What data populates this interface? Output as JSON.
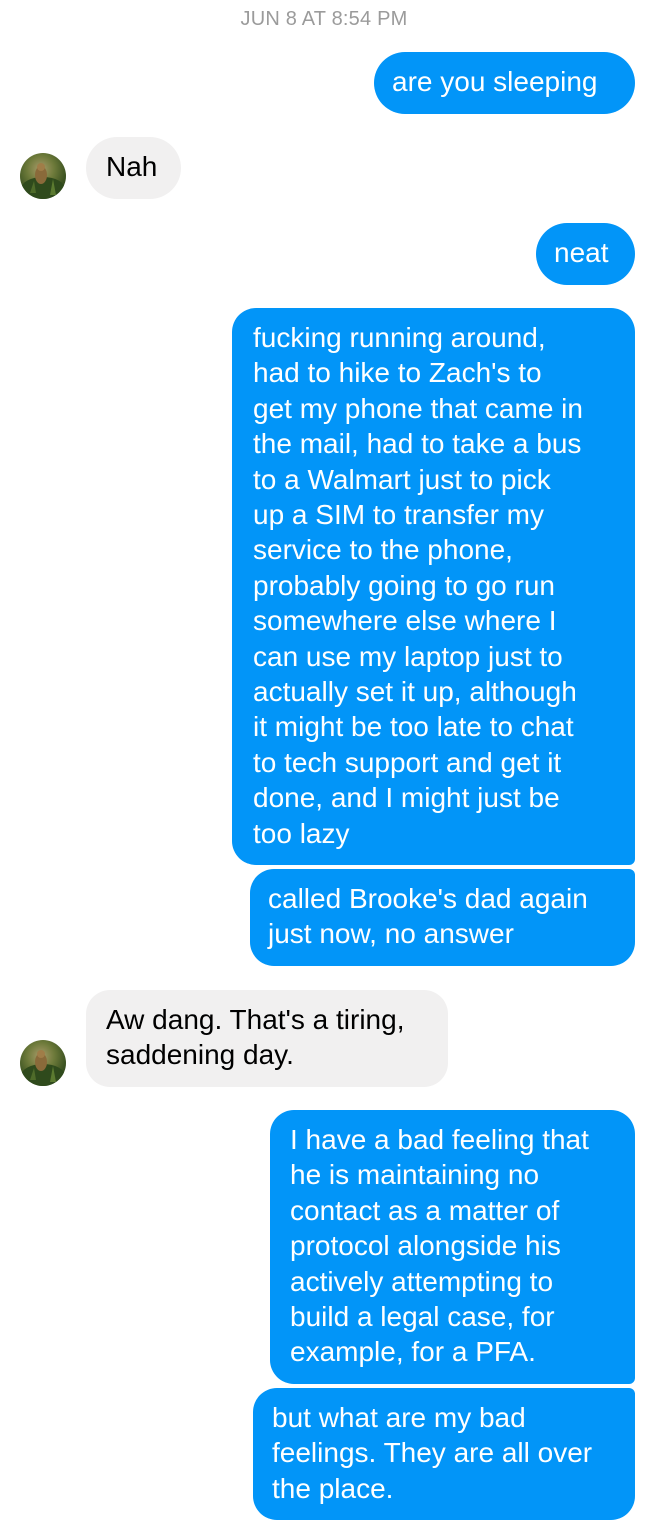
{
  "conversation": {
    "timestamp": "JUN 8 AT 8:54 PM",
    "messages": [
      {
        "sender": "me",
        "text": "are you sleeping"
      },
      {
        "sender": "contact",
        "text": "Nah"
      },
      {
        "sender": "me",
        "text": "neat"
      },
      {
        "sender": "me",
        "text": "fucking running around,\nhad to hike to Zach's to\nget my phone that came in\nthe mail, had to take a bus\nto a Walmart just to pick\nup a SIM to transfer my\nservice to the phone,\nprobably going to go run\nsomewhere else where I\ncan use my laptop just to\nactually set it up, although\nit might be too late to chat\nto tech support and get it\ndone, and I might just be\ntoo lazy"
      },
      {
        "sender": "me",
        "text": "called Brooke's dad again\njust now, no answer"
      },
      {
        "sender": "contact",
        "text": "Aw dang. That's a tiring,\nsaddening day."
      },
      {
        "sender": "me",
        "text": "I have a bad feeling that\nhe is maintaining no\ncontact as a matter of\nprotocol alongside his\nactively attempting to\nbuild a legal case, for\nexample, for a PFA."
      },
      {
        "sender": "me",
        "text": "but what are my bad\nfeelings. They are all over\nthe place."
      }
    ]
  },
  "contact_avatar": {
    "icon": "contact-avatar-photo"
  },
  "colors": {
    "outgoing_bubble": "#0295f8",
    "incoming_bubble": "#f1f0f0",
    "timestamp": "#9b9b9b"
  }
}
